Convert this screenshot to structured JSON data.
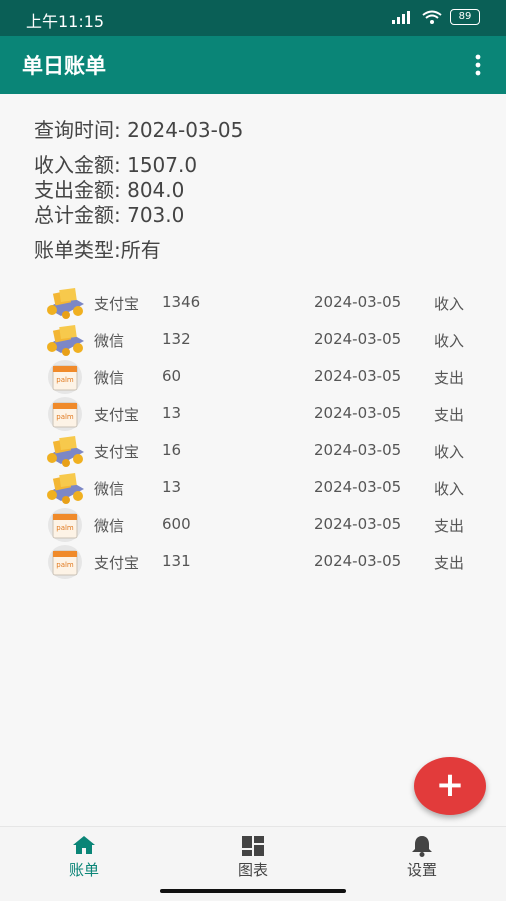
{
  "status_bar": {
    "time": "上午11:15",
    "battery": "89"
  },
  "app_bar": {
    "title": "单日账单",
    "menu_icon": "more-vert-icon"
  },
  "summary": {
    "query": "查询时间:  2024-03-05",
    "income": "收入金额:  1507.0",
    "expense": "支出金额:  804.0",
    "total": "总计金额:  703.0",
    "type": "账单类型:所有"
  },
  "bills": [
    {
      "icon": "income-coins-icon",
      "channel": "支付宝",
      "amount": "1346",
      "date": "2024-03-05",
      "kind": "收入"
    },
    {
      "icon": "income-coins-icon",
      "channel": "微信",
      "amount": "132",
      "date": "2024-03-05",
      "kind": "收入"
    },
    {
      "icon": "expense-bag-icon",
      "channel": "微信",
      "amount": "60",
      "date": "2024-03-05",
      "kind": "支出"
    },
    {
      "icon": "expense-bag-icon",
      "channel": "支付宝",
      "amount": "13",
      "date": "2024-03-05",
      "kind": "支出"
    },
    {
      "icon": "income-coins-icon",
      "channel": "支付宝",
      "amount": "16",
      "date": "2024-03-05",
      "kind": "收入"
    },
    {
      "icon": "income-coins-icon",
      "channel": "微信",
      "amount": "13",
      "date": "2024-03-05",
      "kind": "收入"
    },
    {
      "icon": "expense-bag-icon",
      "channel": "微信",
      "amount": "600",
      "date": "2024-03-05",
      "kind": "支出"
    },
    {
      "icon": "expense-bag-icon",
      "channel": "支付宝",
      "amount": "131",
      "date": "2024-03-05",
      "kind": "支出"
    }
  ],
  "fab": {
    "label": "+"
  },
  "bottom_nav": {
    "tabs": [
      {
        "label": "账单",
        "icon": "home-icon",
        "active": true
      },
      {
        "label": "图表",
        "icon": "dashboard-icon",
        "active": false
      },
      {
        "label": "设置",
        "icon": "bell-icon",
        "active": false
      }
    ]
  },
  "colors": {
    "app_bar": "#0a8577",
    "status_bar": "#0a5f56",
    "fab": "#e23b3b",
    "active_tab": "#0a8577"
  }
}
